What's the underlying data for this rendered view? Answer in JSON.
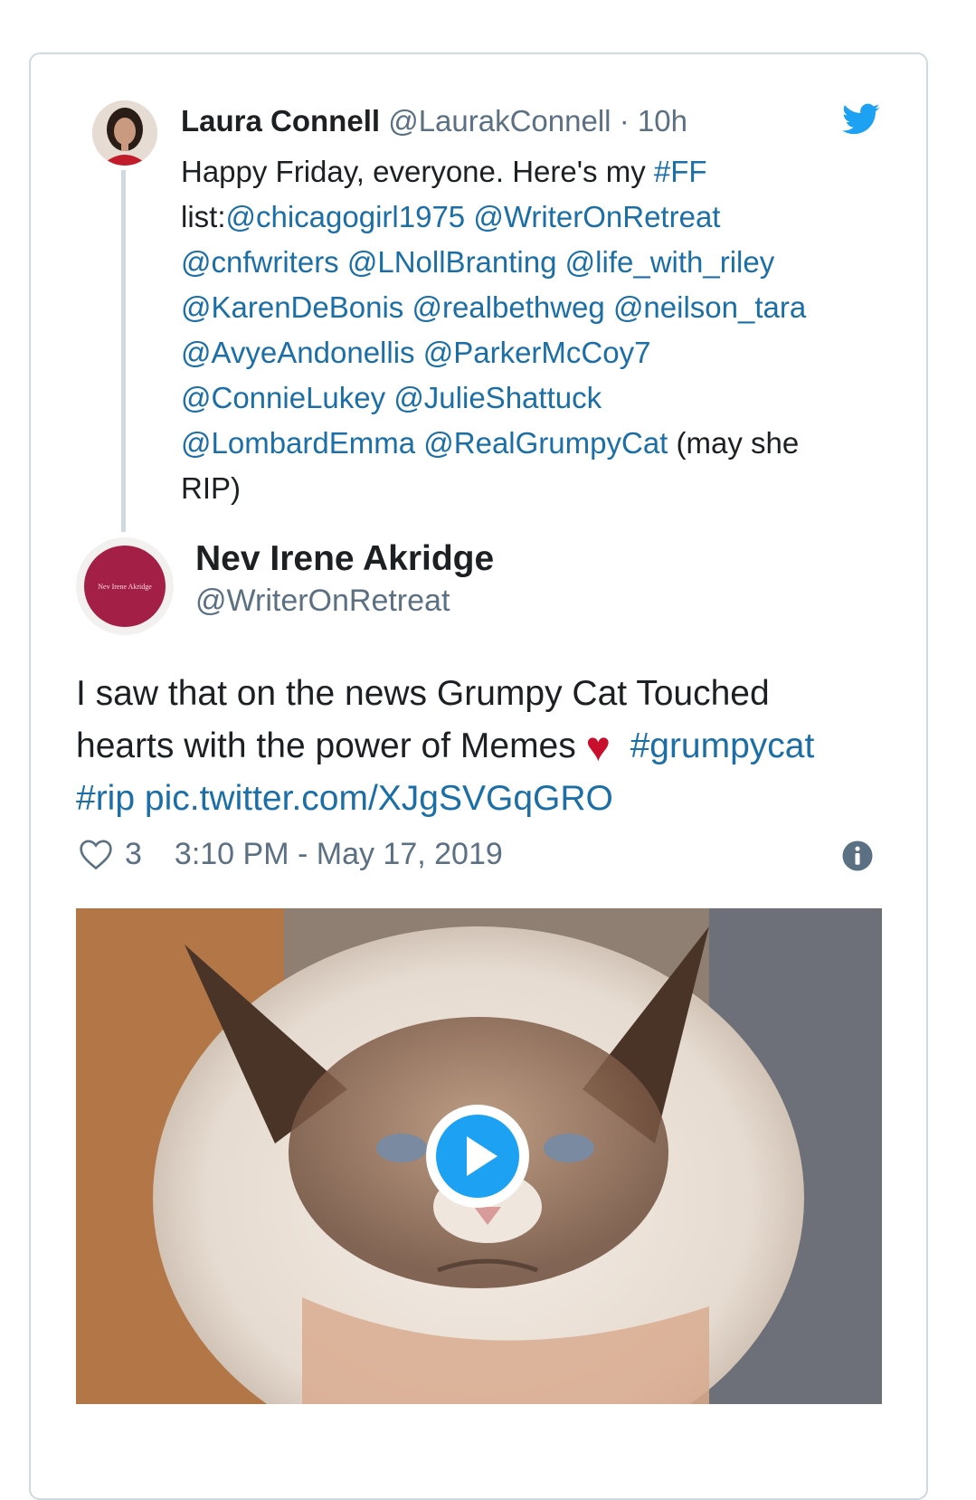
{
  "reply": {
    "name": "Laura Connell",
    "handle": "@LaurakConnell",
    "separator": "·",
    "time": "10h",
    "lines": [
      [
        {
          "t": "Happy Friday, everyone. Here's my ",
          "link": false
        },
        {
          "t": "#FF",
          "link": true
        }
      ],
      [
        {
          "t": "list:",
          "link": false
        },
        {
          "t": "@chicagogirl1975",
          "link": true
        },
        {
          "t": " ",
          "link": false
        },
        {
          "t": "@WriterOnRetreat",
          "link": true
        }
      ],
      [
        {
          "t": "@cnfwriters",
          "link": true
        },
        {
          "t": " ",
          "link": false
        },
        {
          "t": "@LNollBranting",
          "link": true
        },
        {
          "t": " ",
          "link": false
        },
        {
          "t": "@life_with_riley",
          "link": true
        }
      ],
      [
        {
          "t": "@KarenDeBonis",
          "link": true
        },
        {
          "t": " ",
          "link": false
        },
        {
          "t": "@realbethweg",
          "link": true
        },
        {
          "t": " ",
          "link": false
        },
        {
          "t": "@neilson_tara",
          "link": true
        }
      ],
      [
        {
          "t": "@AvyeAndonellis",
          "link": true
        },
        {
          "t": " ",
          "link": false
        },
        {
          "t": "@ParkerMcCoy7",
          "link": true
        }
      ],
      [
        {
          "t": "@ConnieLukey",
          "link": true
        },
        {
          "t": " ",
          "link": false
        },
        {
          "t": "@JulieShattuck",
          "link": true
        }
      ],
      [
        {
          "t": "@LombardEmma",
          "link": true
        },
        {
          "t": " ",
          "link": false
        },
        {
          "t": "@RealGrumpyCat",
          "link": true
        },
        {
          "t": " (may she",
          "link": false
        }
      ],
      [
        {
          "t": "RIP)",
          "link": false
        }
      ]
    ]
  },
  "author": {
    "name": "Nev Irene Akridge",
    "handle": "@WriterOnRetreat",
    "avatar_text": "Nev Irene Akridge"
  },
  "tweet": {
    "text_line1": "I saw that on the news Grumpy Cat Touched",
    "text_line2_prefix": "hearts with the power of Memes ",
    "heart_emoji": "♥",
    "hashtag1": "#grumpycat",
    "hashtag2": "#rip",
    "pic_link": "pic.twitter.com/XJgSVGqGRO"
  },
  "meta": {
    "like_count": "3",
    "timestamp": "3:10 PM - May 17, 2019"
  },
  "media": {
    "description_icon": "play-icon"
  },
  "colors": {
    "link": "#1b6fa6",
    "twitter_blue": "#1da1f2",
    "muted": "#5b7083",
    "heart": "#c8102e",
    "border": "#cfd9de"
  }
}
